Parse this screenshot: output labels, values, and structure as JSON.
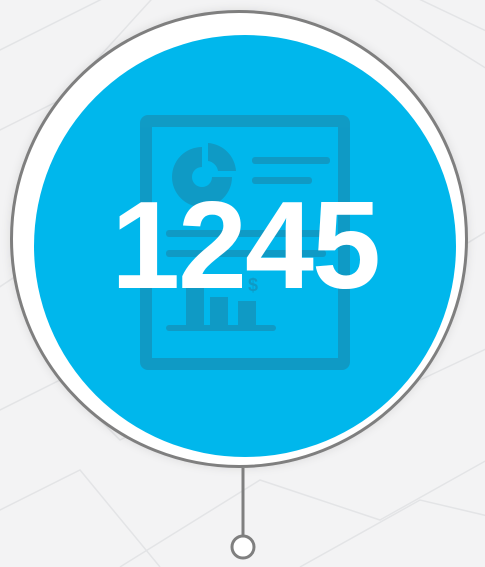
{
  "counter": {
    "value": "1245"
  },
  "icons": {
    "document": "financial-report-icon",
    "currency_symbol": "$"
  },
  "colors": {
    "background": "#f3f3f4",
    "ring": "#7f7f7f",
    "circle_fill": "#00b7ec",
    "icon_tint": "#1591b8",
    "text": "#ffffff"
  }
}
